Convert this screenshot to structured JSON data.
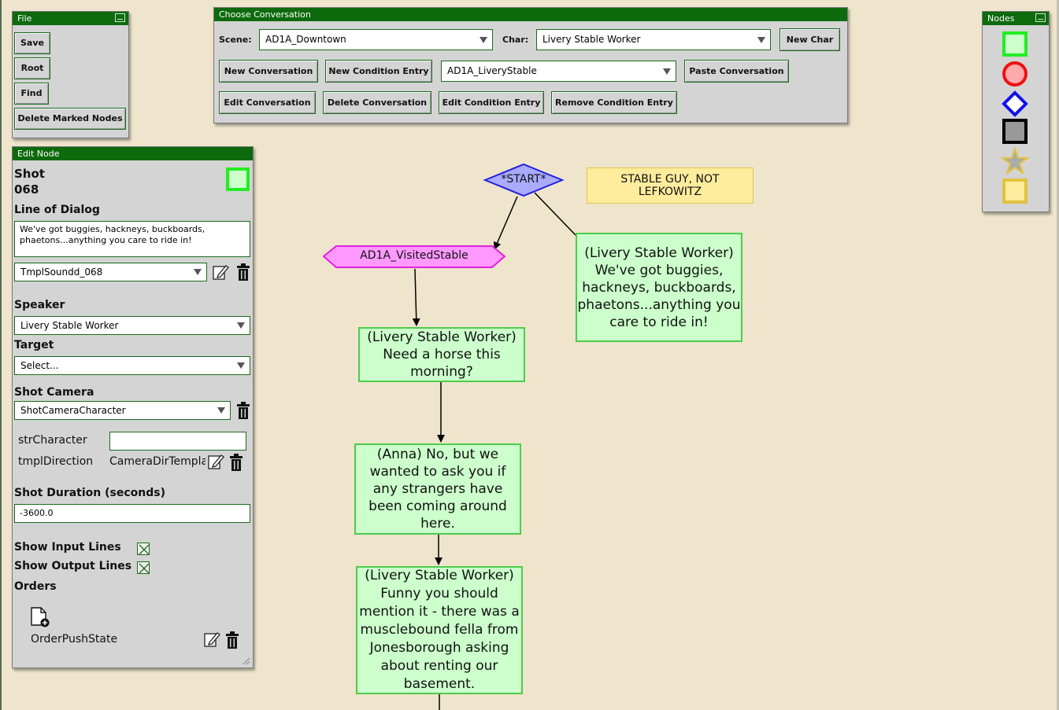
{
  "file_panel": {
    "title": "File",
    "buttons": [
      "Save",
      "Root",
      "Find",
      "Delete Marked Nodes"
    ]
  },
  "choose_conversation": {
    "title": "Choose Conversation",
    "scene_label": "Scene:",
    "scene_value": "AD1A_Downtown",
    "char_label": "Char:",
    "char_value": "Livery Stable Worker",
    "new_char": "New Char",
    "new_conversation": "New Conversation",
    "new_condition_entry": "New Condition Entry",
    "condition_value": "AD1A_LiveryStable",
    "paste_conversation": "Paste Conversation",
    "edit_conversation": "Edit Conversation",
    "delete_conversation": "Delete Conversation",
    "edit_condition_entry": "Edit Condition Entry",
    "remove_condition_entry": "Remove Condition Entry"
  },
  "nodes_panel": {
    "title": "Nodes",
    "types": [
      "dialog-node-icon",
      "circle-node-icon",
      "diamond-node-icon",
      "square-node-icon",
      "star-node-icon",
      "note-node-icon"
    ]
  },
  "edit_node": {
    "title": "Edit Node",
    "shot_title_1": "Shot",
    "shot_title_2": "068",
    "line_of_dialog_label": "Line of Dialog",
    "line_of_dialog_value": "We've got buggies, hackneys, buckboards, phaetons...anything you care to ride in!",
    "sound_value": "TmplSoundd_068",
    "speaker_label": "Speaker",
    "speaker_value": "Livery Stable Worker",
    "target_label": "Target",
    "target_value": "Select...",
    "shot_camera_label": "Shot Camera",
    "shot_camera_value": "ShotCameraCharacter",
    "str_character_label": "strCharacter",
    "str_character_value": "",
    "tmpl_direction_label": "tmplDirection",
    "tmpl_direction_value": "CameraDirTemplat",
    "shot_duration_label": "Shot Duration (seconds)",
    "shot_duration_value": "-3600.0",
    "show_input_lines": "Show Input Lines",
    "show_output_lines": "Show Output Lines",
    "orders_label": "Orders",
    "order_item": "OrderPushState"
  },
  "graph": {
    "start": "*START*",
    "note": "STABLE GUY, NOT LEFKOWITZ",
    "condition": "AD1A_VisitedStable",
    "nodes": [
      "(Livery Stable Worker) We've got buggies, hackneys, buckboards, phaetons...anything you care to ride in!",
      "(Livery Stable Worker) Need a horse this morning?",
      "(Anna) No, but we wanted to ask you if any strangers have been coming around here.",
      "(Livery Stable Worker) Funny you should mention it - there was a musclebound fella from Jonesborough asking about renting our basement."
    ]
  },
  "colors": {
    "title_bar": "#0d6a0d",
    "canvas": "#efe5cc",
    "dialog_node": "#ccffcc",
    "dialog_border": "#4ccc4c",
    "condition_node": "#ff99ff",
    "start_node": "#aaaaff",
    "note": "#fcec9c"
  }
}
